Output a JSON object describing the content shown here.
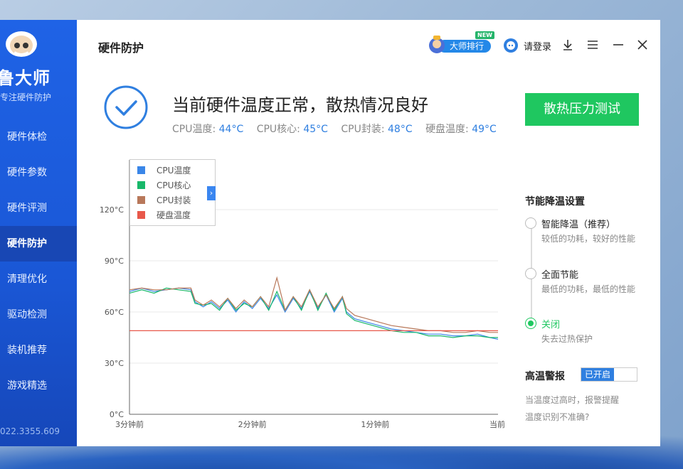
{
  "sidebar": {
    "brand": "鲁大师",
    "subtitle": "专注硬件防护",
    "items": [
      {
        "label": "硬件体检",
        "active": false
      },
      {
        "label": "硬件参数",
        "active": false
      },
      {
        "label": "硬件评测",
        "active": false
      },
      {
        "label": "硬件防护",
        "active": true
      },
      {
        "label": "清理优化",
        "active": false
      },
      {
        "label": "驱动检测",
        "active": false
      },
      {
        "label": "装机推荐",
        "active": false
      },
      {
        "label": "游戏精选",
        "active": false
      }
    ],
    "phone": "022.3355.609"
  },
  "header": {
    "title": "硬件防护",
    "rank_label": "大师排行",
    "rank_new_tag": "NEW",
    "login_label": "请登录"
  },
  "status": {
    "title": "当前硬件温度正常，散热情况良好",
    "temps": [
      {
        "label": "CPU温度:",
        "value": "44°C"
      },
      {
        "label": "CPU核心:",
        "value": "45°C"
      },
      {
        "label": "CPU封装:",
        "value": "48°C"
      },
      {
        "label": "硬盘温度:",
        "value": "49°C"
      }
    ],
    "stress_button": "散热压力测试"
  },
  "colors": {
    "accent_blue": "#2f7fe0",
    "accent_green": "#1fc760",
    "sidebar_blue": "#1f63e6"
  },
  "chart_data": {
    "type": "line",
    "x_tick_labels": [
      "3分钟前",
      "2分钟前",
      "1分钟前",
      "当前"
    ],
    "y_tick_labels": [
      "0°C",
      "30°C",
      "60°C",
      "90°C",
      "120°C"
    ],
    "ylim": [
      0,
      120
    ],
    "xlim": [
      0,
      180
    ],
    "grid": true,
    "legend_placement": "top-left",
    "series": [
      {
        "name": "CPU温度",
        "color": "#3a86e8",
        "values": [
          [
            0,
            72
          ],
          [
            6,
            74
          ],
          [
            12,
            72
          ],
          [
            18,
            73
          ],
          [
            24,
            74
          ],
          [
            30,
            73
          ],
          [
            32,
            66
          ],
          [
            36,
            63
          ],
          [
            40,
            66
          ],
          [
            44,
            62
          ],
          [
            48,
            67
          ],
          [
            52,
            60
          ],
          [
            56,
            66
          ],
          [
            60,
            62
          ],
          [
            64,
            68
          ],
          [
            68,
            62
          ],
          [
            72,
            70
          ],
          [
            76,
            60
          ],
          [
            80,
            68
          ],
          [
            84,
            62
          ],
          [
            88,
            72
          ],
          [
            92,
            62
          ],
          [
            96,
            70
          ],
          [
            100,
            60
          ],
          [
            104,
            68
          ],
          [
            106,
            60
          ],
          [
            110,
            56
          ],
          [
            116,
            54
          ],
          [
            122,
            52
          ],
          [
            128,
            50
          ],
          [
            134,
            49
          ],
          [
            140,
            48
          ],
          [
            146,
            47
          ],
          [
            152,
            47
          ],
          [
            158,
            46
          ],
          [
            164,
            46
          ],
          [
            170,
            47
          ],
          [
            176,
            45
          ],
          [
            180,
            44
          ]
        ]
      },
      {
        "name": "CPU核心",
        "color": "#18b86a",
        "values": [
          [
            0,
            71
          ],
          [
            6,
            73
          ],
          [
            12,
            71
          ],
          [
            18,
            74
          ],
          [
            24,
            73
          ],
          [
            30,
            72
          ],
          [
            32,
            65
          ],
          [
            36,
            64
          ],
          [
            40,
            65
          ],
          [
            44,
            61
          ],
          [
            48,
            68
          ],
          [
            52,
            61
          ],
          [
            56,
            65
          ],
          [
            60,
            63
          ],
          [
            64,
            69
          ],
          [
            68,
            61
          ],
          [
            72,
            72
          ],
          [
            76,
            61
          ],
          [
            80,
            69
          ],
          [
            84,
            61
          ],
          [
            88,
            73
          ],
          [
            92,
            61
          ],
          [
            96,
            71
          ],
          [
            100,
            61
          ],
          [
            104,
            69
          ],
          [
            106,
            59
          ],
          [
            110,
            55
          ],
          [
            116,
            53
          ],
          [
            122,
            51
          ],
          [
            128,
            49
          ],
          [
            134,
            48
          ],
          [
            140,
            48
          ],
          [
            146,
            46
          ],
          [
            152,
            46
          ],
          [
            158,
            45
          ],
          [
            164,
            46
          ],
          [
            170,
            46
          ],
          [
            176,
            45
          ],
          [
            180,
            45
          ]
        ]
      },
      {
        "name": "CPU封装",
        "color": "#b8785a",
        "values": [
          [
            0,
            73
          ],
          [
            6,
            74
          ],
          [
            12,
            73
          ],
          [
            18,
            73
          ],
          [
            24,
            74
          ],
          [
            30,
            74
          ],
          [
            32,
            67
          ],
          [
            36,
            64
          ],
          [
            40,
            67
          ],
          [
            44,
            63
          ],
          [
            48,
            68
          ],
          [
            52,
            62
          ],
          [
            56,
            67
          ],
          [
            60,
            63
          ],
          [
            64,
            69
          ],
          [
            68,
            63
          ],
          [
            72,
            80
          ],
          [
            76,
            61
          ],
          [
            80,
            69
          ],
          [
            84,
            63
          ],
          [
            88,
            73
          ],
          [
            92,
            63
          ],
          [
            96,
            70
          ],
          [
            100,
            62
          ],
          [
            104,
            69
          ],
          [
            106,
            62
          ],
          [
            110,
            58
          ],
          [
            116,
            56
          ],
          [
            122,
            54
          ],
          [
            128,
            52
          ],
          [
            134,
            51
          ],
          [
            140,
            50
          ],
          [
            146,
            49
          ],
          [
            152,
            49
          ],
          [
            158,
            48
          ],
          [
            164,
            48
          ],
          [
            170,
            49
          ],
          [
            176,
            48
          ],
          [
            180,
            48
          ]
        ]
      },
      {
        "name": "硬盘温度",
        "color": "#e8584a",
        "values": [
          [
            0,
            49
          ],
          [
            36,
            49
          ],
          [
            37,
            49
          ],
          [
            180,
            49
          ]
        ]
      }
    ]
  }
}
